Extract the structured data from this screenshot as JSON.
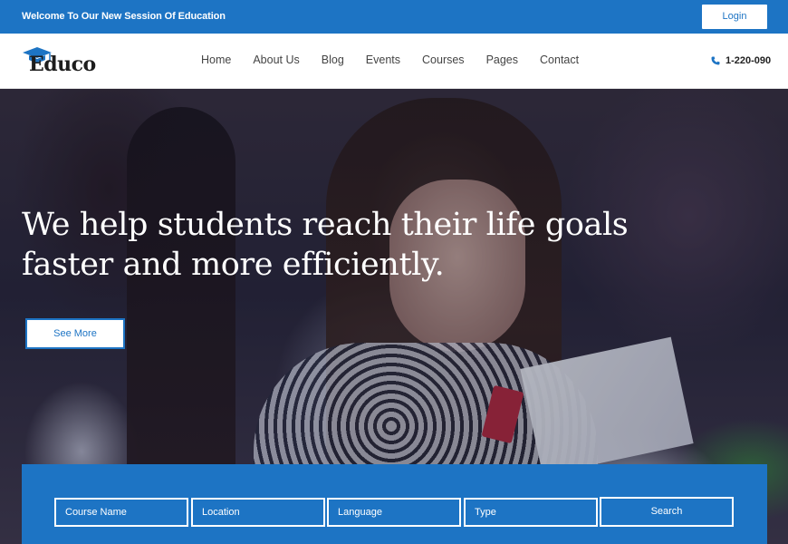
{
  "topbar": {
    "welcome_text": "Welcome To Our New Session Of Education",
    "login_label": "Login"
  },
  "header": {
    "logo_text": "Educo",
    "logo_icon": "graduation-cap-icon",
    "nav": [
      "Home",
      "About Us",
      "Blog",
      "Events",
      "Courses",
      "Pages",
      "Contact"
    ],
    "phone_icon": "phone-icon",
    "phone": "1-220-090"
  },
  "hero": {
    "headline_line1": "We help students reach their life goals",
    "headline_line2": "faster and more efficiently.",
    "see_more_label": "See More"
  },
  "search": {
    "course_name": "Course Name",
    "location": "Location",
    "language": "Language",
    "type": "Type",
    "button_label": "Search"
  },
  "colors": {
    "brand_blue": "#1d74c4",
    "white": "#ffffff",
    "nav_text": "#444444"
  }
}
